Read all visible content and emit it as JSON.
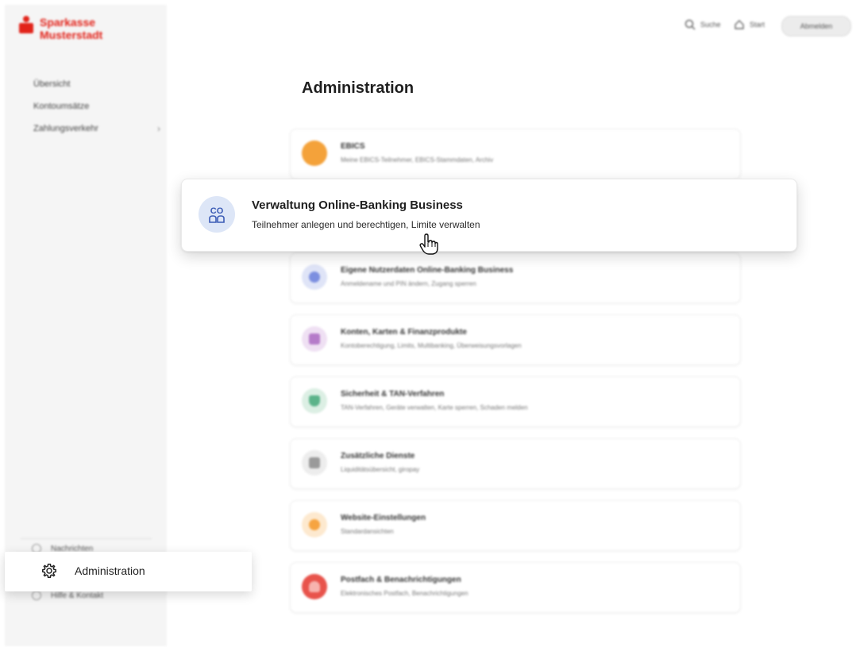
{
  "brand": {
    "line1": "Sparkasse",
    "line2": "Musterstadt"
  },
  "sidebar": {
    "items": [
      {
        "label": "Übersicht"
      },
      {
        "label": "Kontoumsätze"
      },
      {
        "label": "Zahlungsverkehr"
      }
    ],
    "bottom": [
      {
        "label": "Nachrichten"
      },
      {
        "label": "Hilfe & Kontakt"
      }
    ],
    "active_item": "Administration"
  },
  "header": {
    "search_label": "Suche",
    "start_label": "Start",
    "logout_label": "Abmelden"
  },
  "main": {
    "title": "Administration",
    "cards": [
      {
        "title": "EBICS",
        "subtitle": "Meine EBICS-Teilnehmer, EBICS-Stammdaten, Archiv",
        "color": "#f4a23a"
      },
      {
        "title": "Eigene Nutzerdaten Online-Banking Business",
        "subtitle": "Anmeldename und PIN ändern, Zugang sperren",
        "color": "#7c8fe0"
      },
      {
        "title": "Konten, Karten & Finanzprodukte",
        "subtitle": "Kontoberechtigung, Limits, Multibanking, Überweisungsvorlagen",
        "color": "#b57bc9"
      },
      {
        "title": "Sicherheit & TAN-Verfahren",
        "subtitle": "TAN-Verfahren, Geräte verwalten, Karte sperren, Schaden melden",
        "color": "#5cb38a"
      },
      {
        "title": "Zusätzliche Dienste",
        "subtitle": "Liquiditätsübersicht, giropay",
        "color": "#9a9a9a"
      },
      {
        "title": "Website-Einstellungen",
        "subtitle": "Standardansichten",
        "color": "#f6a441"
      },
      {
        "title": "Postfach & Benachrichtigungen",
        "subtitle": "Elektronisches Postfach, Benachrichtigungen",
        "color": "#e8534b"
      }
    ],
    "highlighted": {
      "title": "Verwaltung Online-Banking Business",
      "subtitle": "Teilnehmer anlegen und berechtigen, Limite verwalten",
      "icon_text": "CO"
    }
  },
  "colors": {
    "brand_red": "#e2231a",
    "highlight_icon_bg": "#dde6f7",
    "icon_blue": "#3b5bb5"
  }
}
